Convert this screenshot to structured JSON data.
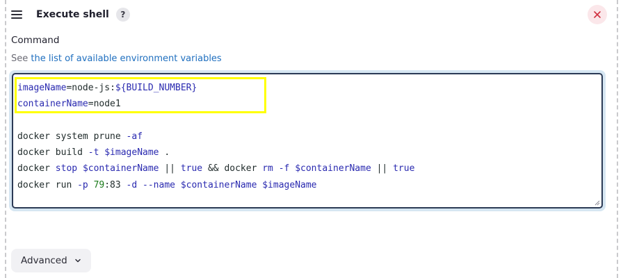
{
  "step": {
    "title": "Execute shell",
    "help_label": "?",
    "close_icon": "close-icon"
  },
  "command": {
    "label": "Command",
    "env_prefix": "See ",
    "env_link": "the list of available environment variables",
    "lines": [
      [
        {
          "t": "imageName",
          "c": "v"
        },
        {
          "t": "=node-js:",
          "c": "o"
        },
        {
          "t": "${BUILD_NUMBER}",
          "c": "s"
        }
      ],
      [
        {
          "t": "containerName",
          "c": "v"
        },
        {
          "t": "=node1",
          "c": "o"
        }
      ],
      [],
      [
        {
          "t": "docker system prune ",
          "c": "k"
        },
        {
          "t": "-af",
          "c": "f"
        }
      ],
      [
        {
          "t": "docker build ",
          "c": "k"
        },
        {
          "t": "-t",
          "c": "f"
        },
        {
          "t": " ",
          "c": "k"
        },
        {
          "t": "$imageName",
          "c": "v"
        },
        {
          "t": " .",
          "c": "k"
        }
      ],
      [
        {
          "t": "docker ",
          "c": "k"
        },
        {
          "t": "stop",
          "c": "f"
        },
        {
          "t": " ",
          "c": "k"
        },
        {
          "t": "$containerName",
          "c": "v"
        },
        {
          "t": " || ",
          "c": "k"
        },
        {
          "t": "true",
          "c": "f"
        },
        {
          "t": " && docker ",
          "c": "k"
        },
        {
          "t": "rm",
          "c": "f"
        },
        {
          "t": " ",
          "c": "k"
        },
        {
          "t": "-f",
          "c": "f"
        },
        {
          "t": " ",
          "c": "k"
        },
        {
          "t": "$containerName",
          "c": "v"
        },
        {
          "t": " || ",
          "c": "k"
        },
        {
          "t": "true",
          "c": "f"
        }
      ],
      [
        {
          "t": "docker run ",
          "c": "k"
        },
        {
          "t": "-p",
          "c": "f"
        },
        {
          "t": " ",
          "c": "k"
        },
        {
          "t": "79",
          "c": "n"
        },
        {
          "t": ":83 ",
          "c": "k"
        },
        {
          "t": "-d",
          "c": "f"
        },
        {
          "t": " ",
          "c": "k"
        },
        {
          "t": "--name",
          "c": "f"
        },
        {
          "t": " ",
          "c": "k"
        },
        {
          "t": "$containerName",
          "c": "v"
        },
        {
          "t": " ",
          "c": "k"
        },
        {
          "t": "$imageName",
          "c": "v"
        }
      ]
    ]
  },
  "advanced": {
    "label": "Advanced"
  },
  "colors": {
    "highlight": "#ffff00",
    "link": "#1f6fbf",
    "close_bg": "#fbe7ea",
    "close_fg": "#d03040"
  }
}
